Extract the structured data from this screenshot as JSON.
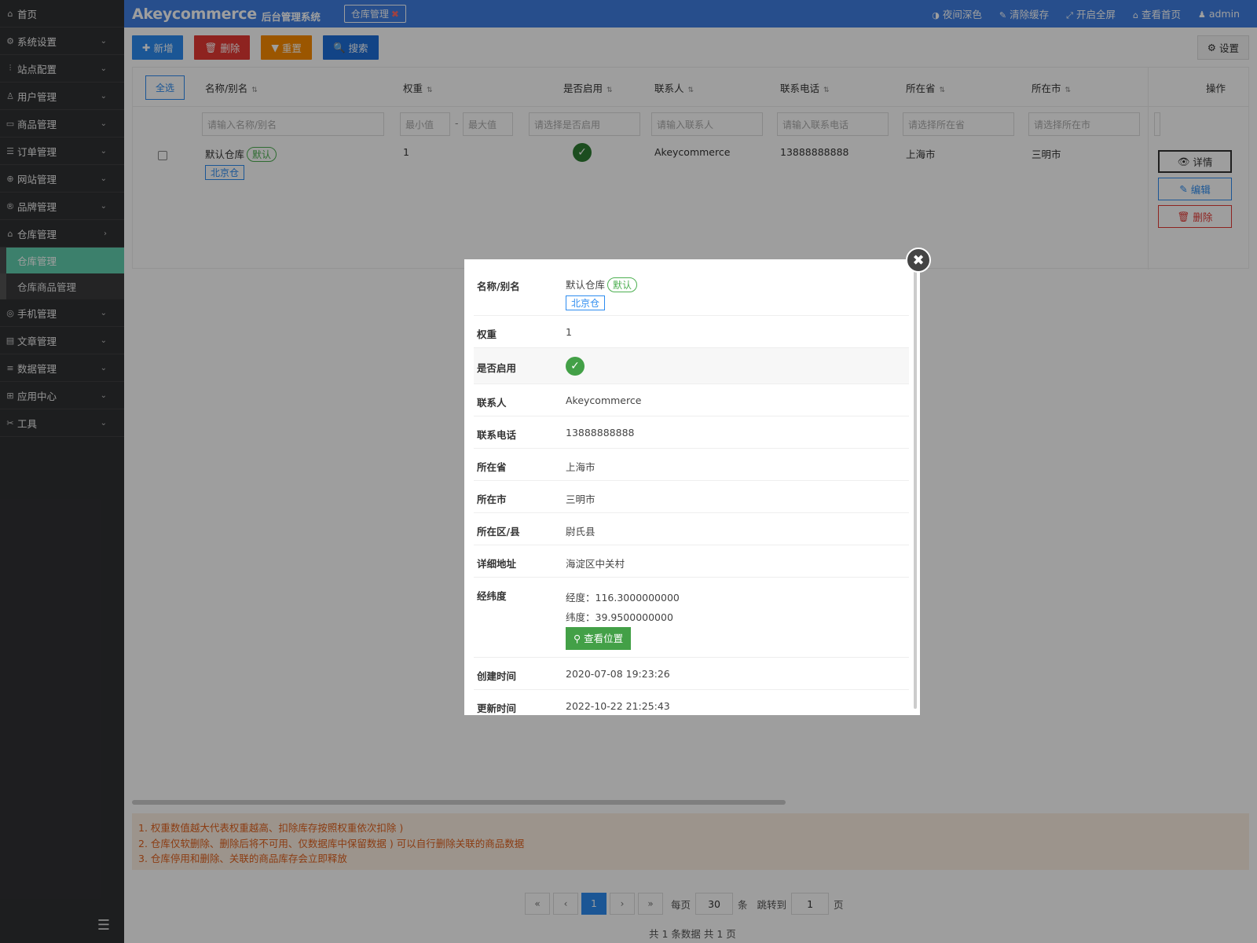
{
  "sidebar": {
    "home": "首页",
    "items": [
      {
        "icon": "gear-icon",
        "label": "系统设置"
      },
      {
        "icon": "sliders-icon",
        "label": "站点配置"
      },
      {
        "icon": "user-icon",
        "label": "用户管理"
      },
      {
        "icon": "box-icon",
        "label": "商品管理"
      },
      {
        "icon": "list-icon",
        "label": "订单管理"
      },
      {
        "icon": "globe-icon",
        "label": "网站管理"
      },
      {
        "icon": "registered-icon",
        "label": "品牌管理"
      },
      {
        "icon": "warehouse-icon",
        "label": "仓库管理"
      }
    ],
    "sub_items": [
      {
        "label": "仓库管理",
        "active": true
      },
      {
        "label": "仓库商品管理",
        "active": false
      }
    ],
    "items_after": [
      {
        "icon": "mobile-icon",
        "label": "手机管理"
      },
      {
        "icon": "file-icon",
        "label": "文章管理"
      },
      {
        "icon": "database-icon",
        "label": "数据管理"
      },
      {
        "icon": "apps-icon",
        "label": "应用中心"
      },
      {
        "icon": "tools-icon",
        "label": "工具"
      }
    ]
  },
  "topbar": {
    "brand": "Akeycommerce",
    "brand_sub": "后台管理系统",
    "tab": "仓库管理",
    "links": [
      {
        "icon": "contrast-icon",
        "label": "夜间深色"
      },
      {
        "icon": "brush-icon",
        "label": "清除缓存"
      },
      {
        "icon": "fullscreen-icon",
        "label": "开启全屏"
      },
      {
        "icon": "home-icon",
        "label": "查看首页"
      },
      {
        "icon": "user-icon",
        "label": "admin"
      }
    ]
  },
  "toolbar": {
    "add": "新增",
    "delete": "删除",
    "reset": "重置",
    "search": "搜索",
    "settings": "设置"
  },
  "table": {
    "select_all": "全选",
    "headers": [
      "名称/别名",
      "权重",
      "是否启用",
      "联系人",
      "联系电话",
      "所在省",
      "所在市",
      "操作"
    ],
    "filters": {
      "name": "请输入名称/别名",
      "min": "最小值",
      "max": "最大值",
      "enabled": "请选择是否启用",
      "contact": "请输入联系人",
      "phone": "请输入联系电话",
      "province": "请选择所在省",
      "city": "请选择所在市"
    },
    "row": {
      "name": "默认仓库",
      "default_badge": "默认",
      "alias": "北京仓",
      "weight": "1",
      "contact": "Akeycommerce",
      "phone": "13888888888",
      "province": "上海市",
      "city": "三明市"
    },
    "ops": {
      "detail": "详情",
      "edit": "编辑",
      "delete": "删除"
    }
  },
  "notice": [
    "1. 权重数值越大代表权重越高、扣除库存按照权重依次扣除 )",
    "2. 仓库仅软删除、删除后将不可用、仅数据库中保留数据 ) 可以自行删除关联的商品数据",
    "3. 仓库停用和删除、关联的商品库存会立即释放"
  ],
  "pager": {
    "first": "«",
    "prev": "‹",
    "current": "1",
    "next": "›",
    "last": "»",
    "per_page_label": "每页",
    "per_page": "30",
    "per_page_unit": "条",
    "jump_label": "跳转到",
    "jump_value": "1",
    "jump_unit": "页",
    "summary": "共 1 条数据   共 1 页"
  },
  "modal": {
    "rows": [
      {
        "label": "名称/别名"
      },
      {
        "label": "权重",
        "value": "1"
      },
      {
        "label": "是否启用"
      },
      {
        "label": "联系人",
        "value": "Akeycommerce"
      },
      {
        "label": "联系电话",
        "value": "13888888888"
      },
      {
        "label": "所在省",
        "value": "上海市"
      },
      {
        "label": "所在市",
        "value": "三明市"
      },
      {
        "label": "所在区/县",
        "value": "尉氏县"
      },
      {
        "label": "详细地址",
        "value": "海淀区中关村"
      },
      {
        "label": "经纬度"
      },
      {
        "label": "创建时间",
        "value": "2020-07-08 19:23:26"
      },
      {
        "label": "更新时间",
        "value": "2022-10-22 21:25:43"
      }
    ],
    "name": "默认仓库",
    "default_badge": "默认",
    "alias": "北京仓",
    "longitude": "经度：116.3000000000",
    "latitude": "纬度：39.9500000000",
    "view_location": "查看位置"
  },
  "colors": {
    "topbar": "#3f7fe3",
    "sidebar": "#303133",
    "active_menu": "#61cfae"
  }
}
